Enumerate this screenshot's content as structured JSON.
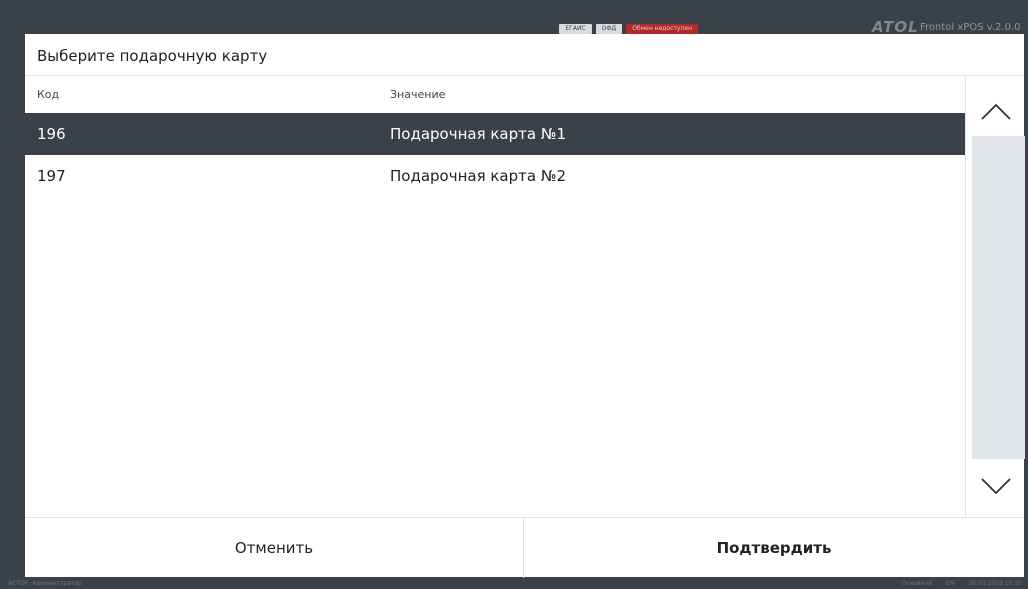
{
  "topbar": {
    "badges": [
      "ЕГАИС",
      "ОФД"
    ],
    "alert_badge": "Обмен недоступен",
    "logo": "ATOL",
    "app_version": "Frontol xPOS v.2.0.0"
  },
  "dialog": {
    "title": "Выберите подарочную карту",
    "columns": {
      "code": "Код",
      "value": "Значение"
    },
    "rows": [
      {
        "code": "196",
        "value": "Подарочная карта №1",
        "selected": true
      },
      {
        "code": "197",
        "value": "Подарочная карта №2",
        "selected": false
      }
    ],
    "cancel_label": "Отменить",
    "confirm_label": "Подтвердить"
  },
  "statusbar": {
    "user": "АСТОР. Администратор",
    "mode": "Основной",
    "lang": "EN",
    "datetime": "26.03.2018 10:30"
  },
  "colors": {
    "background": "#3a4149",
    "selected_row": "#3a4149",
    "scroll_track": "#e3e7ec",
    "alert_badge": "#b02a2a"
  }
}
